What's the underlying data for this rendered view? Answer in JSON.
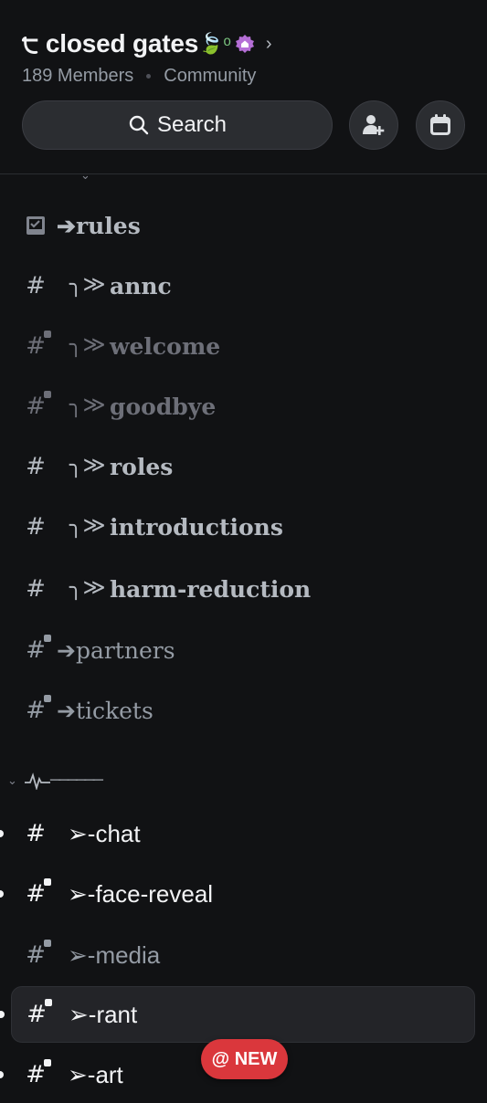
{
  "header": {
    "server_prefix": "੮",
    "server_name": "closed gates",
    "server_emoji": "🍃ᵒ",
    "member_count": "189 Members",
    "server_type": "Community",
    "search_label": "Search"
  },
  "channels": [
    {
      "icon": "rules-icon",
      "label": "➔rules",
      "style": "serif-bold",
      "color": "normal"
    },
    {
      "icon": "hash-icon",
      "prefix": "╮≫",
      "label": "annc",
      "style": "serif-bold",
      "color": "normal"
    },
    {
      "icon": "locked-hash-icon",
      "prefix": "╮≫",
      "label": "welcome",
      "style": "serif-bold",
      "color": "dim"
    },
    {
      "icon": "locked-hash-icon",
      "prefix": "╮≫",
      "label": "goodbye",
      "style": "serif-bold",
      "color": "dim"
    },
    {
      "icon": "hash-icon",
      "prefix": "╮≫",
      "label": "roles",
      "style": "serif-bold",
      "color": "normal"
    },
    {
      "icon": "hash-icon",
      "prefix": "╮≫",
      "label": "introductions",
      "style": "serif-bold",
      "color": "normal"
    },
    {
      "icon": "hash-icon",
      "prefix": "╮≫",
      "label": "harm-reduction",
      "style": "serif-bold",
      "color": "normal"
    },
    {
      "icon": "locked-hash-icon",
      "label": "➔partners",
      "style": "serif",
      "color": "mid"
    },
    {
      "icon": "locked-hash-icon",
      "label": "➔tickets",
      "style": "serif",
      "color": "mid"
    }
  ],
  "category": {
    "label": "──────"
  },
  "channels2": [
    {
      "icon": "hash-icon",
      "label": "➢-chat",
      "color": "bright",
      "unread": true
    },
    {
      "icon": "locked-hash-icon",
      "label": "➢-face-reveal",
      "color": "bright",
      "unread": true
    },
    {
      "icon": "locked-hash-icon",
      "label": "➢-media",
      "color": "mid",
      "unread": false
    },
    {
      "icon": "locked-hash-icon",
      "label": "➢-rant",
      "color": "bright",
      "unread": true,
      "selected": true
    },
    {
      "icon": "locked-hash-icon",
      "label": "➢-art",
      "color": "bright",
      "unread": true
    }
  ],
  "new_badge": "@ NEW",
  "colors": {
    "background": "#111214",
    "accent": "#da373c",
    "boost": "#c77dff"
  }
}
